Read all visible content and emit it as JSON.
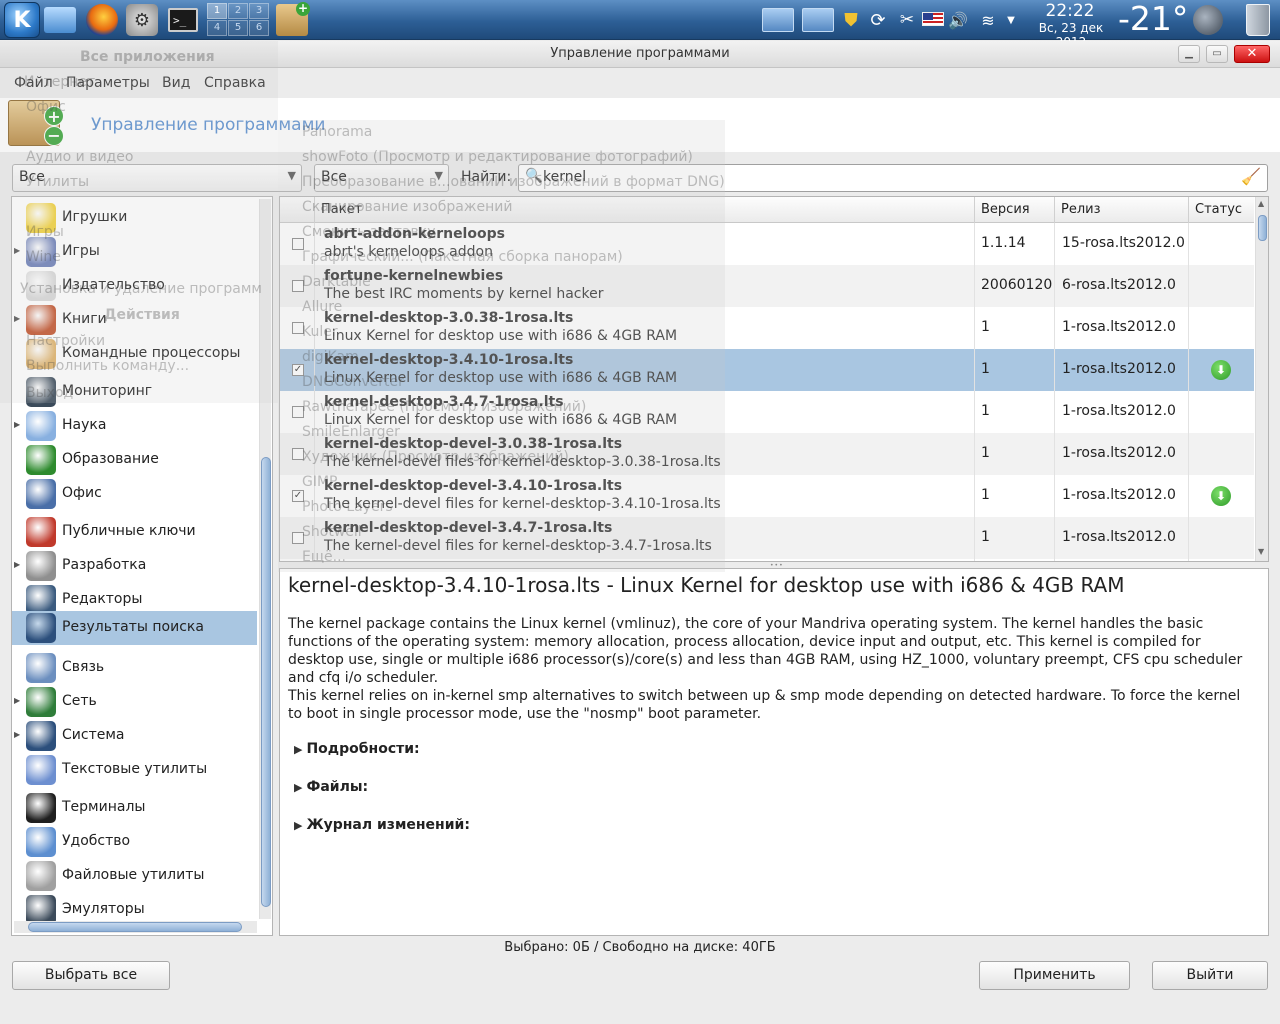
{
  "panel": {
    "pager": [
      "1",
      "2",
      "3",
      "4",
      "5",
      "6"
    ],
    "time": "22:22",
    "date": "Вс, 23 дек 2012",
    "weather": "-21°"
  },
  "window": {
    "title": "Управление программами"
  },
  "menubar": {
    "items": [
      "Файл",
      "Параметры",
      "Вид",
      "Справка"
    ]
  },
  "header": {
    "title": "Управление программами"
  },
  "filters": {
    "group_value": "Все",
    "status_value": "Все",
    "find_label": "Найти:",
    "search_value": "kernel"
  },
  "categories": [
    {
      "label": "Игрушки",
      "expandable": false,
      "selected": false,
      "icon": "toys-icon"
    },
    {
      "label": "Игры",
      "expandable": true,
      "selected": false,
      "icon": "gamepad-icon"
    },
    {
      "label": "Издательство",
      "expandable": false,
      "selected": false,
      "icon": "publishing-icon"
    },
    {
      "label": "Книги",
      "expandable": true,
      "selected": false,
      "icon": "book-icon"
    },
    {
      "label": "Командные процессоры",
      "expandable": false,
      "selected": false,
      "icon": "shell-icon"
    },
    {
      "label": "Мониторинг",
      "expandable": false,
      "selected": false,
      "icon": "monitoring-icon"
    },
    {
      "label": "Наука",
      "expandable": true,
      "selected": false,
      "icon": "science-icon"
    },
    {
      "label": "Образование",
      "expandable": false,
      "selected": false,
      "icon": "education-icon"
    },
    {
      "label": "Офис",
      "expandable": false,
      "selected": false,
      "icon": "office-icon"
    },
    {
      "label": "Публичные ключи",
      "expandable": false,
      "selected": false,
      "icon": "key-icon"
    },
    {
      "label": "Разработка",
      "expandable": true,
      "selected": false,
      "icon": "development-icon"
    },
    {
      "label": "Редакторы",
      "expandable": false,
      "selected": false,
      "icon": "editor-icon"
    },
    {
      "label": "Результаты поиска",
      "expandable": false,
      "selected": true,
      "icon": "search-results-icon"
    },
    {
      "label": "Связь",
      "expandable": false,
      "selected": false,
      "icon": "communication-icon"
    },
    {
      "label": "Сеть",
      "expandable": true,
      "selected": false,
      "icon": "network-icon"
    },
    {
      "label": "Система",
      "expandable": true,
      "selected": false,
      "icon": "system-icon"
    },
    {
      "label": "Текстовые утилиты",
      "expandable": false,
      "selected": false,
      "icon": "text-tools-icon"
    },
    {
      "label": "Терминалы",
      "expandable": false,
      "selected": false,
      "icon": "terminal-icon"
    },
    {
      "label": "Удобство",
      "expandable": false,
      "selected": false,
      "icon": "accessibility-icon"
    },
    {
      "label": "Файловые утилиты",
      "expandable": false,
      "selected": false,
      "icon": "file-tools-icon"
    },
    {
      "label": "Эмуляторы",
      "expandable": false,
      "selected": false,
      "icon": "emulator-icon"
    }
  ],
  "table": {
    "columns": [
      "Пакет",
      "Версия",
      "Релиз",
      "Статус"
    ],
    "rows": [
      {
        "name": "abrt-addon-kerneloops",
        "desc": "abrt's kerneloops addon",
        "version": "1.1.14",
        "release": "15-rosa.lts2012.0",
        "checked": false,
        "selected": false,
        "status": ""
      },
      {
        "name": "fortune-kernelnewbies",
        "desc": "The best IRC moments by kernel hacker",
        "version": "20060120",
        "release": "6-rosa.lts2012.0",
        "checked": false,
        "selected": false,
        "status": ""
      },
      {
        "name": "kernel-desktop-3.0.38-1rosa.lts",
        "desc": "Linux Kernel for desktop use with i686 & 4GB RAM",
        "version": "1",
        "release": "1-rosa.lts2012.0",
        "checked": false,
        "selected": false,
        "status": ""
      },
      {
        "name": "kernel-desktop-3.4.10-1rosa.lts",
        "desc": "Linux Kernel for desktop use with i686 & 4GB RAM",
        "version": "1",
        "release": "1-rosa.lts2012.0",
        "checked": true,
        "selected": true,
        "status": "install-icon"
      },
      {
        "name": "kernel-desktop-3.4.7-1rosa.lts",
        "desc": "Linux Kernel for desktop use with i686 & 4GB RAM",
        "version": "1",
        "release": "1-rosa.lts2012.0",
        "checked": false,
        "selected": false,
        "status": ""
      },
      {
        "name": "kernel-desktop-devel-3.0.38-1rosa.lts",
        "desc": "The kernel-devel files for kernel-desktop-3.0.38-1rosa.lts",
        "version": "1",
        "release": "1-rosa.lts2012.0",
        "checked": false,
        "selected": false,
        "status": ""
      },
      {
        "name": "kernel-desktop-devel-3.4.10-1rosa.lts",
        "desc": "The kernel-devel files for kernel-desktop-3.4.10-1rosa.lts",
        "version": "1",
        "release": "1-rosa.lts2012.0",
        "checked": true,
        "selected": false,
        "status": "install-icon"
      },
      {
        "name": "kernel-desktop-devel-3.4.7-1rosa.lts",
        "desc": "The kernel-devel files for kernel-desktop-3.4.7-1rosa.lts",
        "version": "1",
        "release": "1-rosa.lts2012.0",
        "checked": false,
        "selected": false,
        "status": ""
      }
    ]
  },
  "details": {
    "title": "kernel-desktop-3.4.10-1rosa.lts - Linux Kernel for desktop use with i686 & 4GB RAM",
    "p1": "The kernel package contains the Linux kernel (vmlinuz), the core of your Mandriva operating system. The kernel handles the basic functions of the operating system: memory allocation, process allocation, device input and output, etc. This kernel is compiled for desktop use, single or multiple i686 processor(s)/core(s) and less than 4GB RAM, using HZ_1000, voluntary preempt, CFS cpu scheduler and cfq i/o scheduler.",
    "p2": "This kernel relies on in-kernel smp alternatives to switch between up & smp mode depending on detected hardware. To force the kernel to boot in single processor mode, use the \"nosmp\" boot parameter.",
    "sections": [
      "Подробности:",
      "Файлы:",
      "Журнал изменений:"
    ]
  },
  "status_text": "Выбрано: 0Б / Свободно на диске: 40ГБ",
  "buttons": {
    "select_all": "Выбрать все",
    "apply": "Применить",
    "quit": "Выйти"
  },
  "overlay_menu": {
    "left": [
      "Все приложения",
      "Интернет",
      "Офис",
      "Аудио и видео",
      "Утилиты",
      "Игры",
      "Wine",
      "Установка и удаление программ",
      "Действия",
      "Настройки",
      "Выполнить команду...",
      "Выход"
    ],
    "right": [
      "Panorama",
      "showFoto (Просмотр и редактирование фотографий)",
      "Преобразование в...ованиЙ изображений в формат DNG)",
      "Сканирование изображений",
      "Сменить заставку",
      "Графический... (Пакетная сборка панорам)",
      "Darktable",
      "Allure",
      "Kuler",
      "digiKam",
      "DNGConverter",
      "Rawtherapee (Просмотр изображений)",
      "SmileEnlarger",
      "Художник (Просмотр изображений)",
      "GIMP",
      "Photo Layers",
      "Shotwell",
      "Ещё..."
    ]
  }
}
